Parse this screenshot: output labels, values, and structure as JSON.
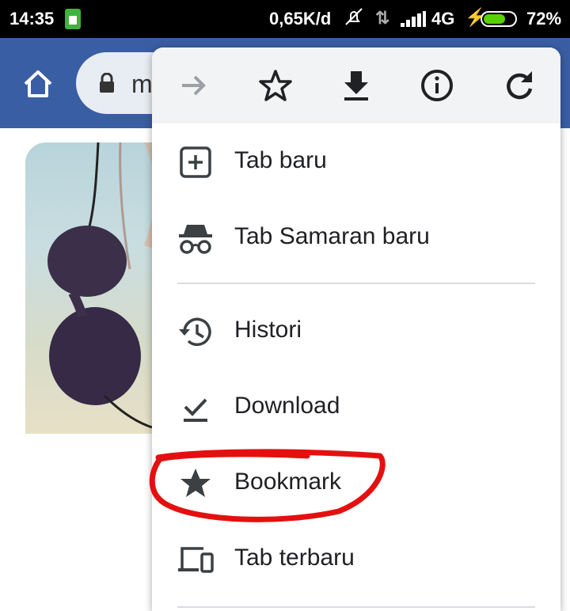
{
  "status_bar": {
    "time": "14:35",
    "network_speed": "0,65K/d",
    "network_type": "4G",
    "battery_percent": "72%",
    "battery_level": 0.72,
    "icons": [
      "sim-icon",
      "mute-icon",
      "data-arrows-icon",
      "signal-icon",
      "charging-icon",
      "battery-icon"
    ]
  },
  "browser_toolbar": {
    "url_text": "m",
    "color": "#3a5ea3",
    "icons": [
      "home-icon",
      "lock-icon"
    ]
  },
  "menu": {
    "toolbar_icons": [
      "forward-icon",
      "bookmark-star-icon",
      "download-icon",
      "info-icon",
      "refresh-icon"
    ],
    "items": [
      {
        "label": "Tab baru",
        "icon": "new-tab-icon"
      },
      {
        "label": "Tab Samaran baru",
        "icon": "incognito-icon"
      },
      {
        "label": "Histori",
        "icon": "history-icon"
      },
      {
        "label": "Download",
        "icon": "downloads-icon"
      },
      {
        "label": "Bookmark",
        "icon": "bookmarks-star-icon"
      },
      {
        "label": "Tab terbaru",
        "icon": "recent-tabs-icon"
      }
    ]
  },
  "annotation": {
    "color": "#e41010",
    "target": "Bookmark"
  }
}
